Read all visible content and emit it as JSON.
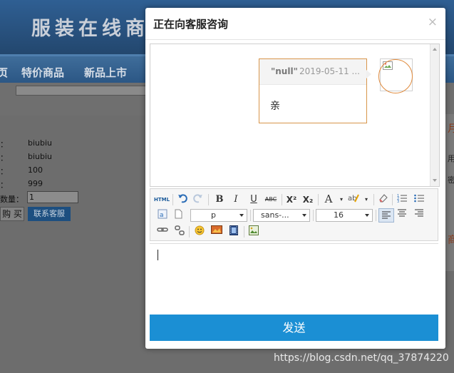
{
  "background": {
    "site_title": "服装在线商",
    "nav": [
      "页",
      "特价商品",
      "新品上市"
    ],
    "product": [
      {
        "label": "：",
        "value": "biubiu"
      },
      {
        "label": "：",
        "value": "biubiu"
      },
      {
        "label": "：",
        "value": "100"
      },
      {
        "label": "：",
        "value": "999"
      }
    ],
    "quantity_label": "数量：",
    "quantity_value": "1",
    "buy_label": "购 买",
    "service_label": "联系客服",
    "side": [
      "用",
      "密"
    ],
    "side_red": [
      "月",
      "商"
    ],
    "watermark": "https://blog.csdn.net/qq_37874220"
  },
  "dialog": {
    "title": "正在向客服咨询",
    "close_glyph": "×",
    "message": {
      "sender": "\"null\"",
      "time": "2019-05-11 ...",
      "text": "亲"
    },
    "toolbar": {
      "html_label": "HTML",
      "bold": "B",
      "italic": "I",
      "underline": "U",
      "strike": "ABC",
      "superscript": "X²",
      "subscript": "X₂",
      "font_color": "A",
      "paragraph": "p",
      "font_family": "sans-...",
      "font_size": "16"
    },
    "send_label": "发送"
  }
}
